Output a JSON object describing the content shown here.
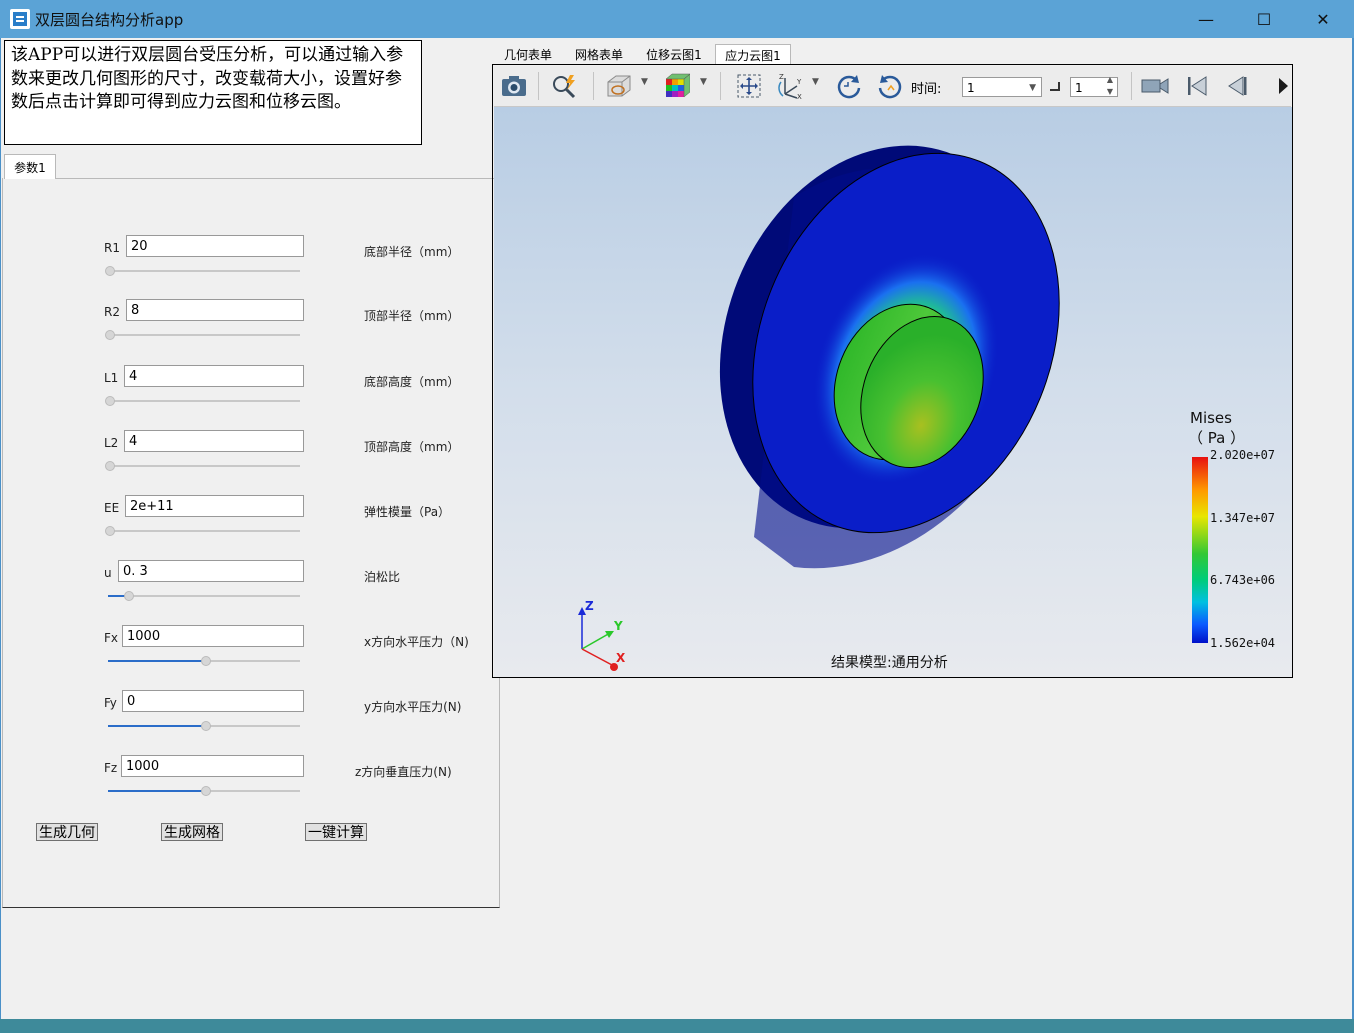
{
  "window": {
    "title": "双层圆台结构分析app",
    "minimize_icon": "—",
    "maximize_icon": "☐",
    "close_icon": "✕"
  },
  "description": "该APP可以进行双层圆台受压分析，可以通过输入参数来更改几何图形的尺寸，改变载荷大小，设置好参数后点击计算即可得到应力云图和位移云图。",
  "left_tabs": [
    "参数1"
  ],
  "params": [
    {
      "label": "R1",
      "value": "20",
      "unit": "底部半径（mm）",
      "slider_fraction": 0.0
    },
    {
      "label": "R2",
      "value": "8",
      "unit": "顶部半径（mm）",
      "slider_fraction": 0.0
    },
    {
      "label": "L1",
      "value": "4",
      "unit": "底部高度（mm）",
      "slider_fraction": 0.0
    },
    {
      "label": "L2",
      "value": "4",
      "unit": "顶部高度（mm）",
      "slider_fraction": 0.0
    },
    {
      "label": "EE",
      "value": "2e+11",
      "unit": "弹性模量（Pa）",
      "slider_fraction": 0.0
    },
    {
      "label": "u",
      "value": "0. 3",
      "unit": "泊松比",
      "slider_fraction": 0.1
    },
    {
      "label": "Fx",
      "value": "1000",
      "unit": "x方向水平压力（N)",
      "slider_fraction": 0.5
    },
    {
      "label": "Fy",
      "value": "0",
      "unit": "y方向水平压力(N)",
      "slider_fraction": 0.5
    },
    {
      "label": "Fz",
      "value": "1000",
      "unit": "z方向垂直压力(N)",
      "slider_fraction": 0.5
    }
  ],
  "buttons": {
    "geometry": "生成几何",
    "mesh": "生成网格",
    "compute": "一键计算"
  },
  "right_tabs": [
    {
      "label": "几何表单",
      "active": false
    },
    {
      "label": "网格表单",
      "active": false
    },
    {
      "label": "位移云图1",
      "active": false
    },
    {
      "label": "应力云图1",
      "active": true
    }
  ],
  "toolbar": {
    "time_label": "时间:",
    "time_value": "1",
    "step_value": "1",
    "icons": [
      "camera-icon",
      "probe-icon",
      "display-mode-icon",
      "colormap-icon",
      "fit-view-icon",
      "axes-view-icon",
      "rotate-cw-icon",
      "rotate-ccw-icon",
      "video-icon",
      "first-frame-icon",
      "prev-frame-icon",
      "next-frame-icon"
    ]
  },
  "legend": {
    "title_line1": "Mises",
    "title_line2": "（ Pa ）",
    "values": [
      "2.020e+07",
      "1.347e+07",
      "6.743e+06",
      "1.562e+04"
    ]
  },
  "axes": {
    "z": "Z",
    "y": "Y",
    "x": "X"
  },
  "model_label": "结果模型:通用分析",
  "colors": {
    "titlebar": "#5ba3d6",
    "accent": "#2b6dc9",
    "mesh_blue": "#0a1ec8",
    "mesh_green": "#2ec22e"
  }
}
